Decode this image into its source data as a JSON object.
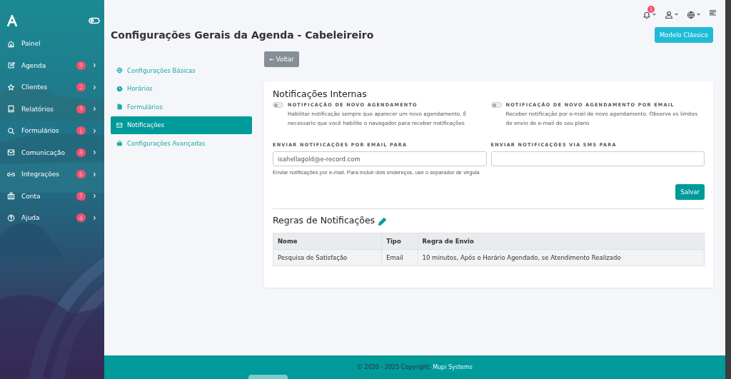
{
  "sidebar": {
    "items": [
      {
        "label": "Painel"
      },
      {
        "label": "Agenda",
        "badge": "9"
      },
      {
        "label": "Clientes",
        "badge": "2"
      },
      {
        "label": "Relatórios",
        "badge": "3"
      },
      {
        "label": "Formulários",
        "badge": "1"
      },
      {
        "label": "Comunicação",
        "badge": "4"
      },
      {
        "label": "Integrações",
        "badge": "6"
      },
      {
        "label": "Conta",
        "badge": "7"
      },
      {
        "label": "Ajuda",
        "badge": "4"
      }
    ]
  },
  "topbar": {
    "notification_count": "1"
  },
  "page": {
    "title": "Configurações Gerais da Agenda - Cabeleireiro",
    "classic_button": "Modelo Clássico",
    "back_button": "← Voltar"
  },
  "settings_nav": [
    {
      "label": "Configurações Básicas",
      "selected": false
    },
    {
      "label": "Horários",
      "selected": false
    },
    {
      "label": "Formulários",
      "selected": false
    },
    {
      "label": "Notificações",
      "selected": true
    },
    {
      "label": "Configurações Avançadas",
      "selected": false
    }
  ],
  "internal": {
    "title": "Notificações Internas",
    "toggles": [
      {
        "label": "NOTIFICAÇÃO DE NOVO AGENDAMENTO",
        "on": false,
        "help": "Habilitar notificação sempre que aparecer um novo agendamento. É necessario que você habilite o navagador para receber notificações"
      },
      {
        "label": "NOTIFICAÇÃO DE NOVO AGENDAMENTO POR EMAIL",
        "on": false,
        "help": "Receber notificação por e-mail de novo agendamento. Observe os limites de envio de e-mail do seu plano"
      }
    ],
    "fields": [
      {
        "label": "ENVIAR NOTIFICAÇÕES POR EMAIL PARA",
        "value": "isahellagold@e-record.com",
        "help": "Enviar notificações por e-mail. Para incluir dois endereços, use o separador de virgula"
      },
      {
        "label": "ENVIAR NOTIFICAÇÕES VIA SMS PARA"
      }
    ],
    "save_button": "Salvar"
  },
  "rules": {
    "title": "Regras de Notificações",
    "columns": [
      "Nome",
      "Tipo",
      "Regra de Envio"
    ],
    "rows": [
      [
        "Pesquisa de Satisfação",
        "Email",
        "10 minutos, Após o Horário Agendado, se Atendimento Realizado"
      ]
    ]
  },
  "footer": {
    "text": "© 2020 - 2025 Copyright: ",
    "link": "Mupi Systems"
  }
}
